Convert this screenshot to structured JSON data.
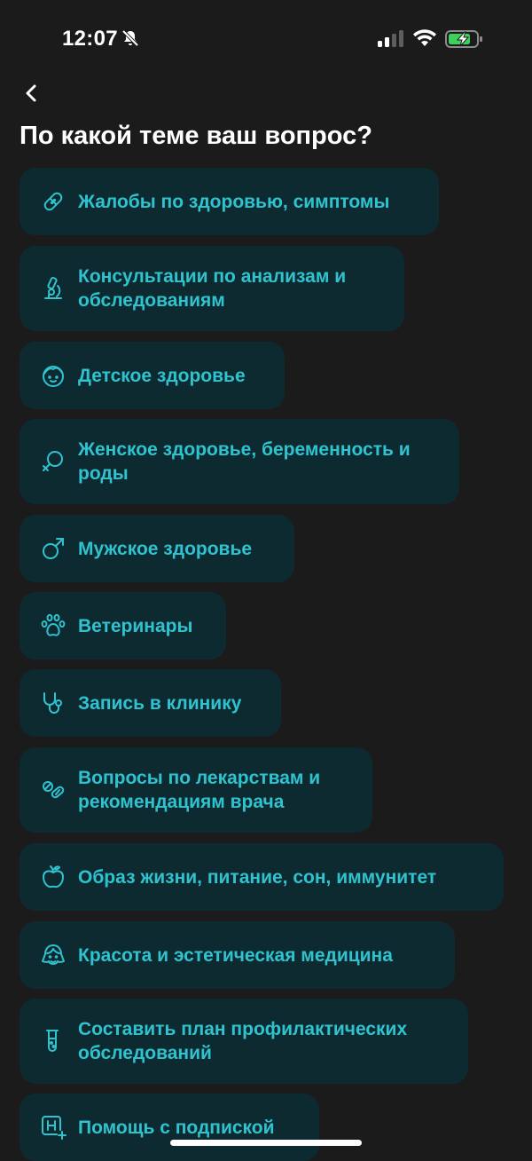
{
  "status": {
    "time": "12:07",
    "bell_icon": "bell-slash-icon",
    "signal_icon": "cellular-signal-icon",
    "wifi_icon": "wifi-icon",
    "battery_icon": "battery-charging-icon"
  },
  "nav": {
    "back_icon": "chevron-left-icon"
  },
  "page": {
    "title": "По какой теме ваш вопрос?"
  },
  "topics": [
    {
      "label": "Жалобы по здоровью, симптомы",
      "icon": "bandage-icon"
    },
    {
      "label": "Консультации по анализам и обследованиям",
      "icon": "microscope-icon"
    },
    {
      "label": "Детское здоровье",
      "icon": "child-face-icon"
    },
    {
      "label": "Женское здоровье, беременность и роды",
      "icon": "female-symbol-icon"
    },
    {
      "label": "Мужское здоровье",
      "icon": "male-symbol-icon"
    },
    {
      "label": "Ветеринары",
      "icon": "paw-icon"
    },
    {
      "label": "Запись в клинику",
      "icon": "stethoscope-icon"
    },
    {
      "label": "Вопросы по лекарствам и рекомендациям врача",
      "icon": "pills-icon"
    },
    {
      "label": "Образ жизни, питание, сон, иммунитет",
      "icon": "apple-icon"
    },
    {
      "label": "Красота и эстетическая медицина",
      "icon": "woman-face-icon"
    },
    {
      "label": "Составить план профилактических обследований",
      "icon": "test-tube-icon"
    },
    {
      "label": "Помощь с подпиской",
      "icon": "hospital-plus-icon"
    }
  ],
  "colors": {
    "background": "#1b1b1c",
    "card": "#0e2a31",
    "accent": "#2fc3cf"
  }
}
